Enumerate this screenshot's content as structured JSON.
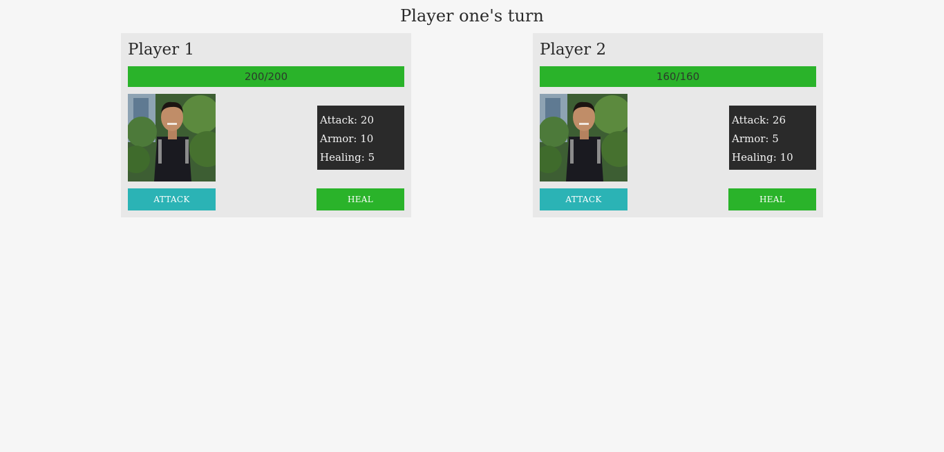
{
  "turn_title": "Player one's turn",
  "colors": {
    "background": "#f6f6f6",
    "card": "#e8e8e8",
    "health": "#2ab32a",
    "stats_box": "#2a2a2a",
    "attack_button": "#2bb3b5",
    "heal_button": "#2ab32a"
  },
  "players": [
    {
      "name": "Player 1",
      "health": {
        "current": 200,
        "max": 200,
        "text": "200/200"
      },
      "avatar": "player-portrait",
      "stats": [
        {
          "label": "Attack:",
          "value": "20"
        },
        {
          "label": "Armor:",
          "value": "10"
        },
        {
          "label": "Healing:",
          "value": "5"
        }
      ],
      "attack_label": "ATTACK",
      "heal_label": "HEAL"
    },
    {
      "name": "Player 2",
      "health": {
        "current": 160,
        "max": 160,
        "text": "160/160"
      },
      "avatar": "player-portrait",
      "stats": [
        {
          "label": "Attack:",
          "value": "26"
        },
        {
          "label": "Armor:",
          "value": "5"
        },
        {
          "label": "Healing:",
          "value": "10"
        }
      ],
      "attack_label": "ATTACK",
      "heal_label": "HEAL"
    }
  ]
}
